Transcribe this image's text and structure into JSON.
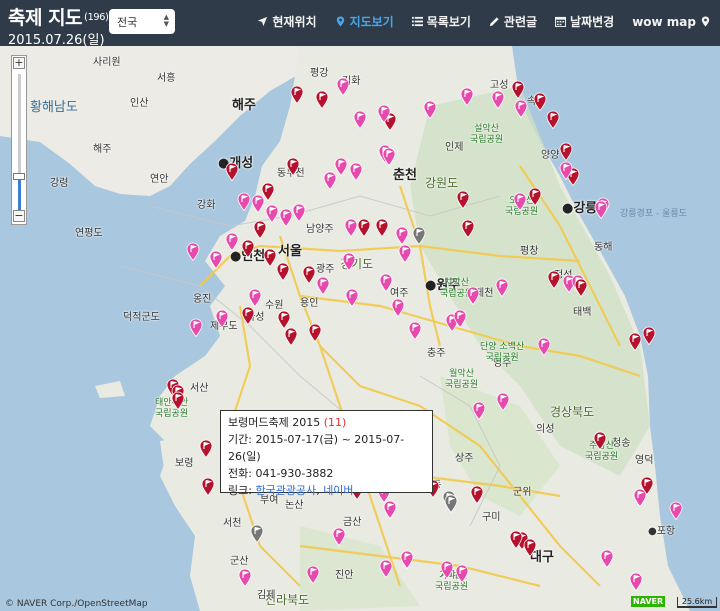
{
  "header": {
    "title": "축제 지도",
    "count": "(196)",
    "date": "2015.07.26(일)",
    "region_select": "전국"
  },
  "nav": [
    {
      "label": "현재위치",
      "icon": "location-arrow-icon",
      "active": false
    },
    {
      "label": "지도보기",
      "icon": "map-marker-icon",
      "active": true
    },
    {
      "label": "목록보기",
      "icon": "list-icon",
      "active": false
    },
    {
      "label": "관련글",
      "icon": "pencil-icon",
      "active": false
    },
    {
      "label": "날짜변경",
      "icon": "calendar-icon",
      "active": false
    },
    {
      "label": "wow map",
      "icon": "map-marker-icon",
      "active": false
    }
  ],
  "zoom": {
    "plus": "+",
    "minus": "−"
  },
  "popup": {
    "title": "보령머드축제 2015",
    "num": "(11)",
    "period_label": "기간:",
    "period": "2015-07-17(금) ~ 2015-07-26(일)",
    "phone_label": "전화:",
    "phone": "041-930-3882",
    "link_label": "링크:",
    "link1": "한국관광공사",
    "sep": ",",
    "link2": "네이버"
  },
  "attribution": "© NAVER Corp./OpenStreetMap",
  "naver_logo": "NAVER",
  "scale": "25.6km",
  "colors": {
    "header": "#2f3b48",
    "active": "#4aa6e8",
    "pink": "#e64aad",
    "red": "#b5122e",
    "gray": "#777777"
  }
}
